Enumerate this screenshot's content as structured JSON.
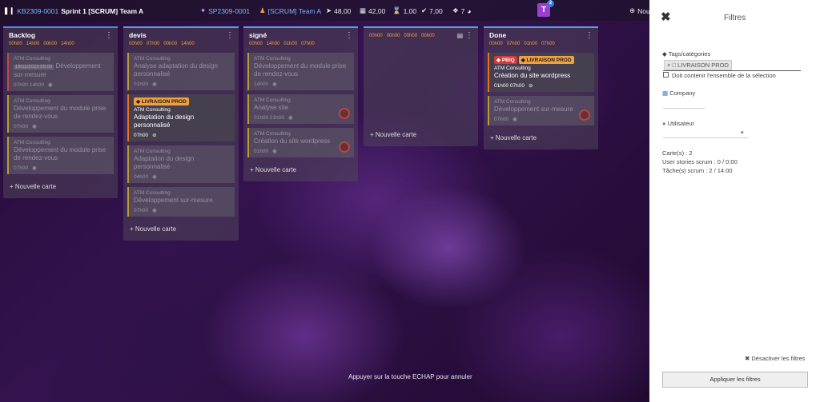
{
  "topbar": {
    "kanban_ref": "KB2309-0001",
    "sprint": "Sprint 1 [SCRUM] Team A",
    "sprint_ref": "SP2309-0001",
    "team": "[SCRUM] Team A",
    "stat_run": "48,00",
    "stat_cal": "42,00",
    "stat_hourglass": "1,00",
    "stat_check": "7,00",
    "stat_tag": "7",
    "badge_letter": "T",
    "badge_count": "2",
    "new_label": "Nou"
  },
  "columns": [
    {
      "title": "Backlog",
      "meta": [
        "00h00",
        "14h00",
        "00h00",
        "14h00"
      ],
      "cards": [
        {
          "company": "ATM Consulting",
          "date": "18/11/2023 00:00",
          "title": "Développement sur-mesure",
          "meta": "07h00  14h00"
        },
        {
          "company": "ATM Consulting",
          "title": "Développement du module prise de rendez-vous",
          "meta": "07h00"
        },
        {
          "company": "ATM Consulting",
          "title": "Développement du module prise de rendez-vous",
          "meta": "07h00"
        }
      ],
      "add": "+ Nouvelle carte"
    },
    {
      "title": "devis",
      "meta": [
        "00h00",
        "07h00",
        "00h00",
        "14h00"
      ],
      "cards": [
        {
          "company": "ATM Consulting",
          "title": "Analyse adaptation du design personnalisé",
          "meta": "01h00"
        },
        {
          "company": "ATM Consulting",
          "tag": "LIVRAISON PROD",
          "title": "Adaptation du design personnalisé",
          "meta": "07h00"
        },
        {
          "company": "ATM Consulting",
          "title": "Adaptation du design personnalisé",
          "meta": "04h00"
        },
        {
          "company": "ATM Consulting",
          "title": "Développement sur-mesure",
          "meta": "07h00"
        }
      ],
      "add": "+ Nouvelle carte"
    },
    {
      "title": "signé",
      "meta": [
        "00h00",
        "14h00",
        "01h00",
        "07h00"
      ],
      "cards": [
        {
          "company": "ATM Consulting",
          "title": "Développement du module prise de rendez-vous",
          "meta": "14h00"
        },
        {
          "company": "ATM Consulting",
          "title": "Analyse site",
          "meta": "01h00  01h00"
        },
        {
          "company": "ATM Consulting",
          "title": "Création du site wordpress",
          "meta": "01h00"
        }
      ],
      "add": "+ Nouvelle carte"
    },
    {
      "title": "",
      "meta": [
        "00h00",
        "00h00",
        "00h00",
        "00h00"
      ],
      "cards": [],
      "add": "+ Nouvelle carte"
    },
    {
      "title": "Done",
      "meta": [
        "00h00",
        "07h00",
        "01h00",
        "07h00"
      ],
      "cards": [
        {
          "company": "ATM Consulting",
          "tags": [
            "PBIQ",
            "LIVRAISON PROD"
          ],
          "title": "Création du site wordpress",
          "meta": "01h00  07h00"
        },
        {
          "company": "ATM Consulting",
          "title": "Développement sur-mesure",
          "meta": "07h00"
        }
      ],
      "add": "+ Nouvelle carte"
    }
  ],
  "hint": "Appuyer sur la touche ECHAP pour annuler",
  "panel": {
    "title": "Filtres",
    "tags_label": "Tags/catégories",
    "chip": "LIVRAISON PROD",
    "must_contain": "Doit contenir l'ensemble de la sélection",
    "company_label": "Company",
    "user_label": "Utilisateur",
    "stat_cards": "Carte(s) : 2",
    "stat_us": "User stories scrum : 0 / 0:00",
    "stat_tasks": "Tâche(s) scrum : 2 / 14:00",
    "reset": "Désactiver les filtres",
    "apply": "Appliquer les filtres"
  },
  "colors": {
    "accent_orange": "#f0a03c",
    "link_blue": "#7fb6ff",
    "badge_purple": "#9b3fd0"
  }
}
